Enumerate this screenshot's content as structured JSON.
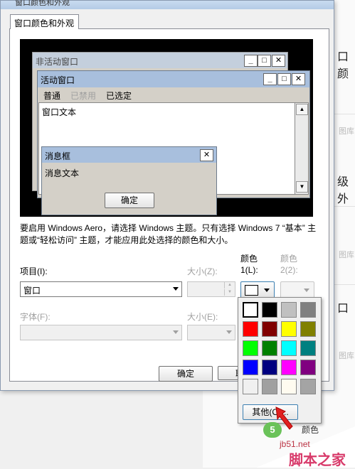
{
  "dialog": {
    "title": "窗口颜色和外观",
    "tab": "窗口颜色和外观"
  },
  "preview": {
    "inactive_title": "非活动窗口",
    "active_title": "活动窗口",
    "menu": [
      "普通",
      "已禁用",
      "已选定"
    ],
    "window_text": "窗口文本",
    "msg_title": "消息框",
    "msg_text": "消息文本",
    "ok": "确定"
  },
  "hint": "要启用 Windows Aero，请选择 Windows 主题。只有选择 Windows 7 “基本” 主题或“轻松访问” 主题，才能应用此处选择的颜色和大小。",
  "form": {
    "item_label": "项目(I):",
    "item_value": "窗口",
    "size_label": "大小(Z):",
    "color1_label_line1": "颜色",
    "color1_label_line2": "1(L):",
    "color2_label_line1": "颜色",
    "color2_label_line2": "2(2):",
    "font_label": "字体(F):",
    "font_size_label": "大小(E):",
    "ok_button": "确定",
    "cancel_button_partial": "取"
  },
  "palette": {
    "colors": [
      "#ffffff",
      "#000000",
      "#c0c0c0",
      "#808080",
      "#ff0000",
      "#800000",
      "#ffff00",
      "#808000",
      "#00ff00",
      "#008000",
      "#00ffff",
      "#008080",
      "#0000ff",
      "#000080",
      "#ff00ff",
      "#800080",
      "#f0f0f0",
      "#a0a0a0",
      "#fffbf0",
      "#a4a4a4"
    ],
    "other_button": "其他(O)..."
  },
  "background": {
    "text1": "口颜",
    "text2": "图库",
    "text3": "级外",
    "text4": "图库",
    "text5": "口",
    "text6": "图库",
    "badge": "5",
    "under_badge": "颜色"
  },
  "watermark": {
    "line1": "jb51.net",
    "line2": "脚本之家"
  }
}
